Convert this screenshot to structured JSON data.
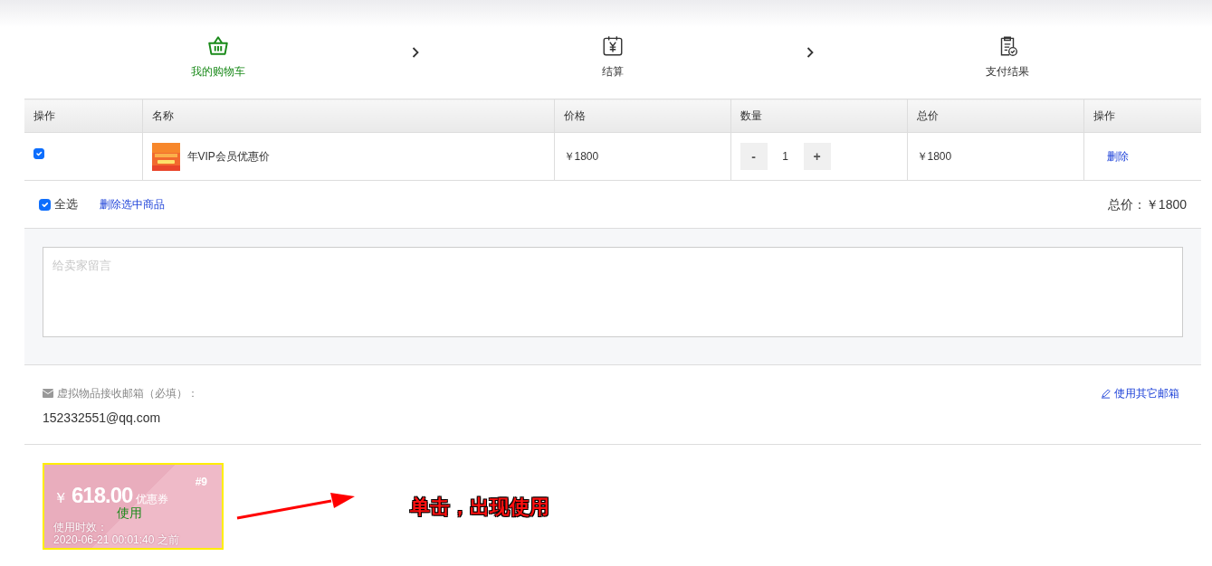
{
  "steps": [
    {
      "label": "我的购物车",
      "selected": true
    },
    {
      "label": "结算",
      "selected": false
    },
    {
      "label": "支付结果",
      "selected": false
    }
  ],
  "table": {
    "columns": [
      "操作",
      "名称",
      "价格",
      "数量",
      "总价",
      "操作"
    ],
    "rows": [
      {
        "checked": true,
        "name": "年VIP会员优惠价",
        "price": "￥1800",
        "quantity": "1",
        "minus": "-",
        "plus": "+",
        "total": "￥1800",
        "action": "删除"
      }
    ]
  },
  "footer": {
    "select_all": {
      "label": "全选",
      "checked": true
    },
    "delete_selected": "删除选中商品",
    "total_label": "总价：",
    "total": "￥1800"
  },
  "message": {
    "placeholder": "给卖家留言"
  },
  "email": {
    "label": "虚拟物品接收邮箱（必填）：",
    "value": "152332551@qq.com",
    "link": "使用其它邮箱"
  },
  "coupon": {
    "currency": "￥",
    "amount": "618.00",
    "type": "优惠券",
    "number": "#9",
    "use": "使用",
    "validity_label": "使用时效：",
    "validity_date": "2020-06-21 00:01:40",
    "validity_suffix": "之前"
  },
  "annotation": {
    "text": "单击，出现使用"
  }
}
